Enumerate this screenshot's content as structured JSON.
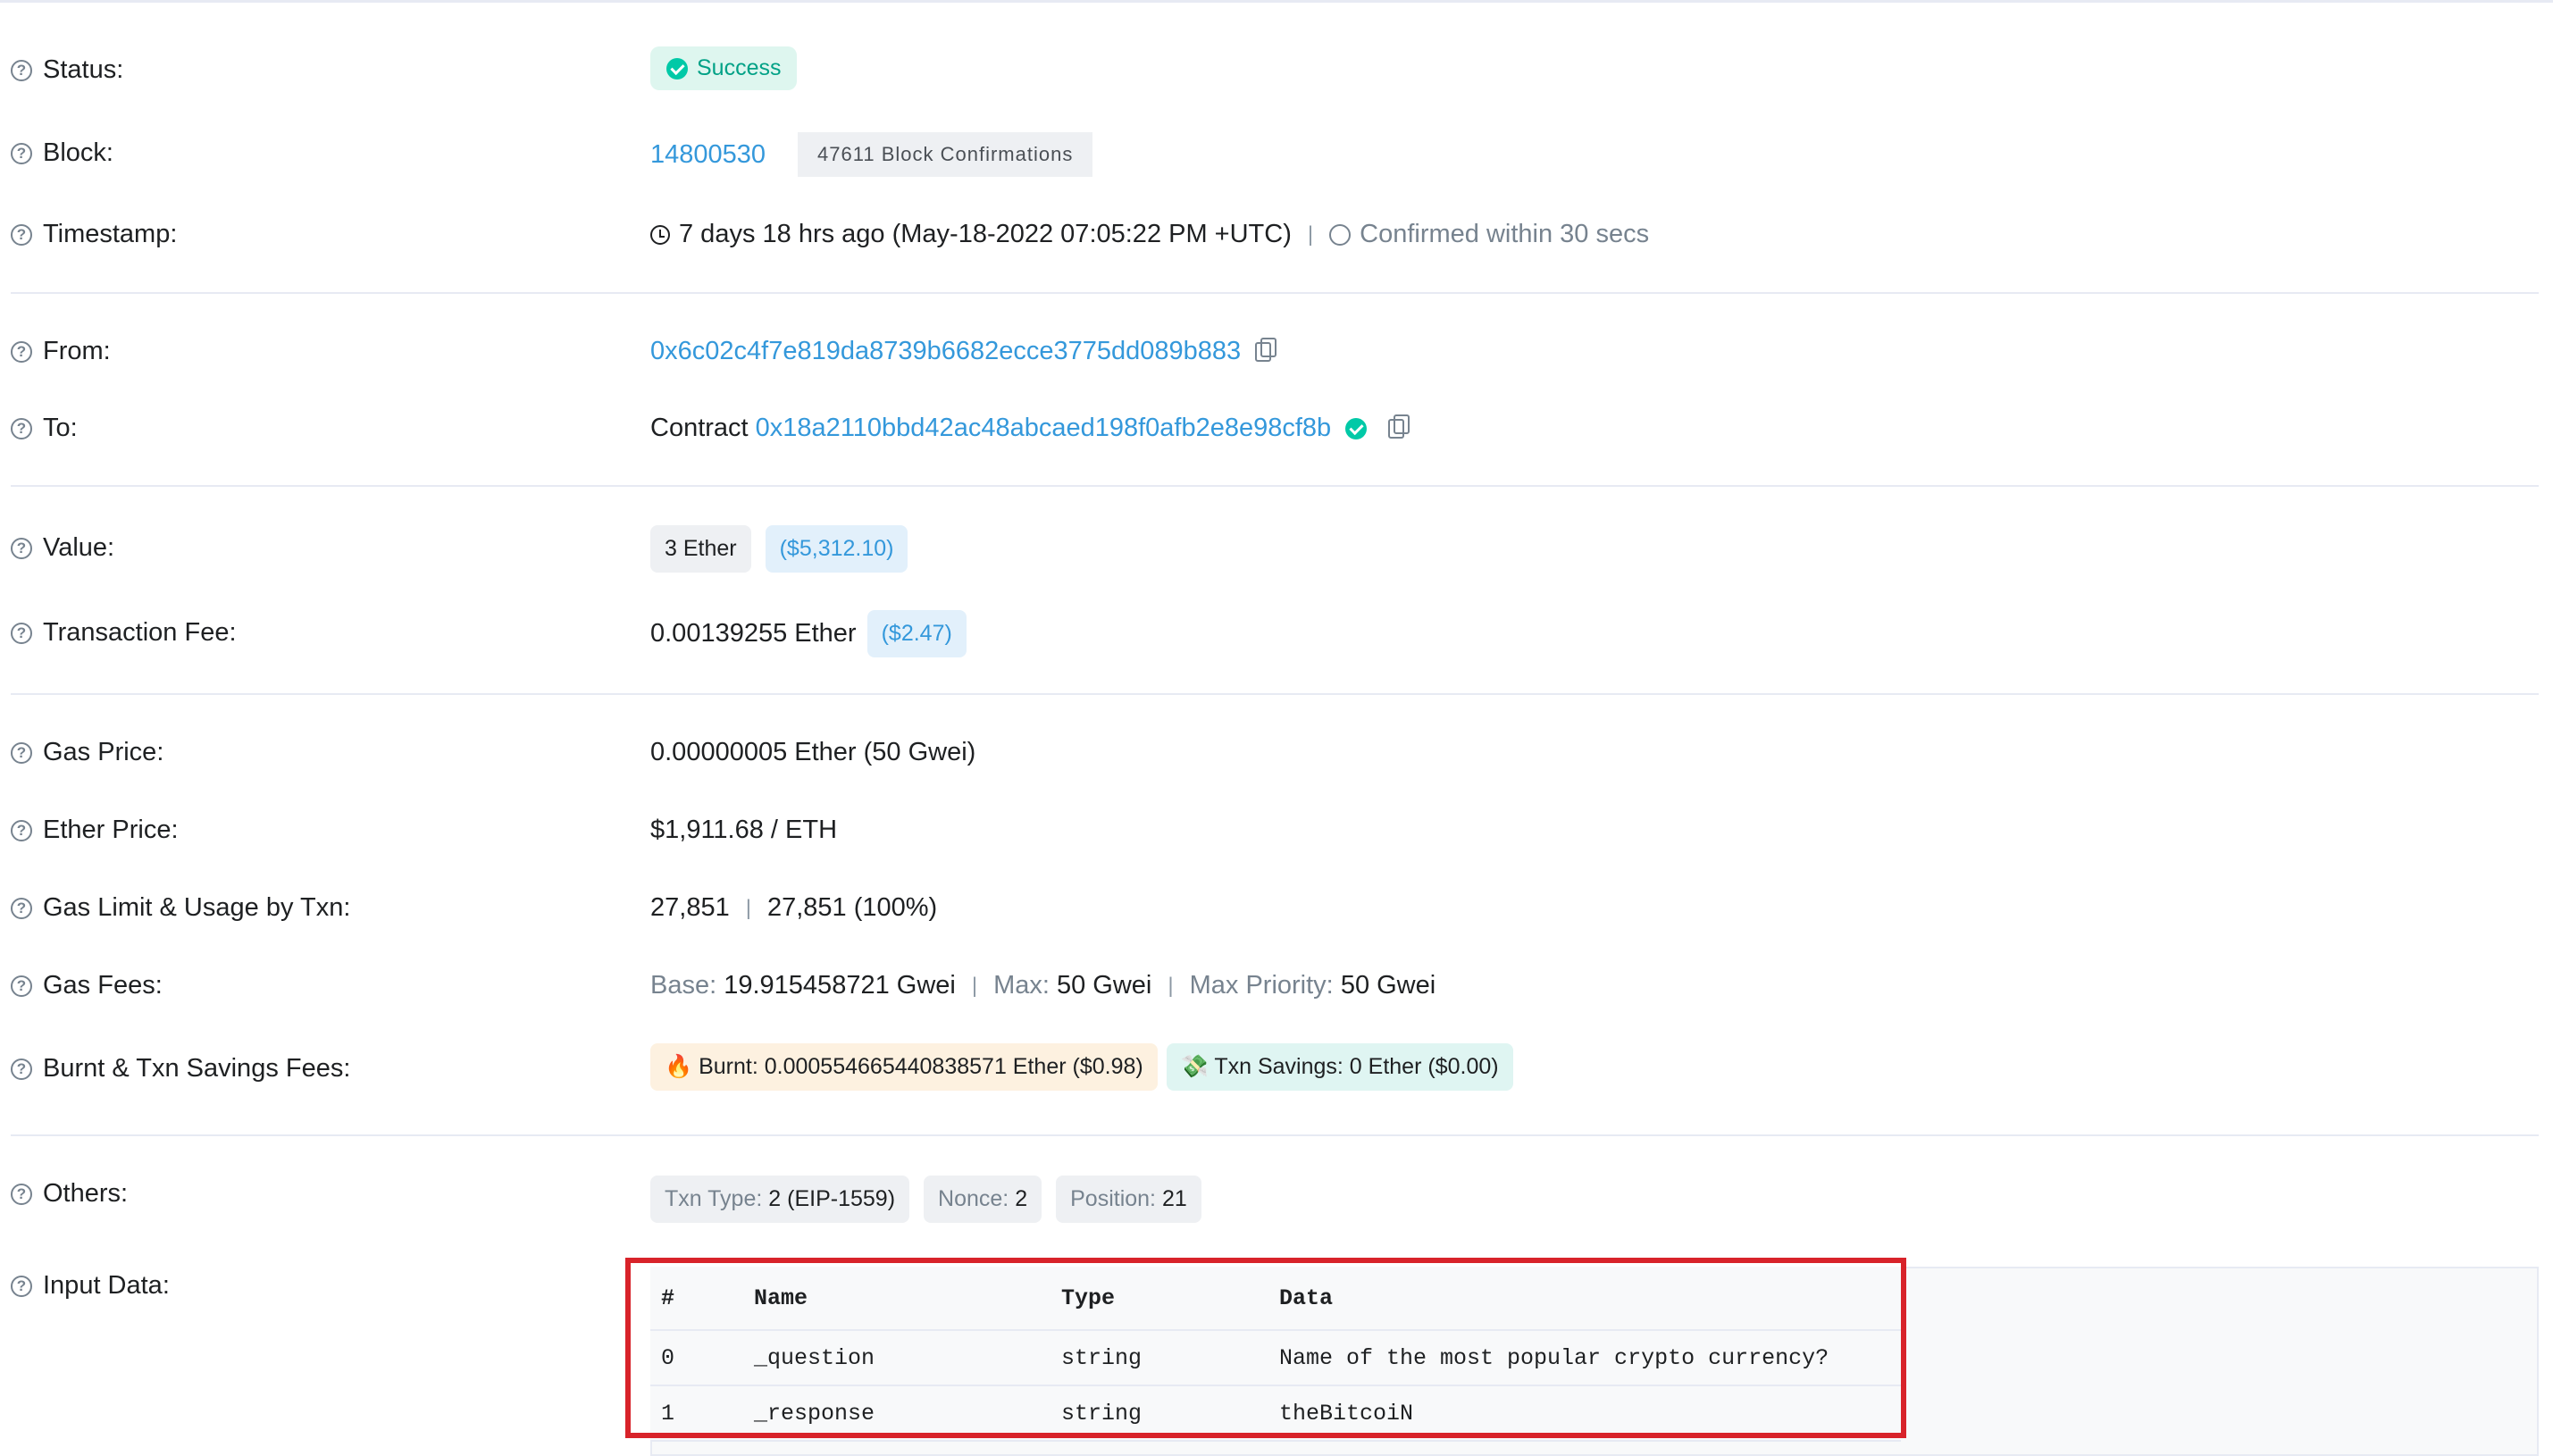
{
  "status": {
    "label": "Status:",
    "value": "Success"
  },
  "block": {
    "label": "Block:",
    "number": "14800530",
    "confirmations": "47611 Block Confirmations"
  },
  "timestamp": {
    "label": "Timestamp:",
    "value": "7 days 18 hrs ago (May-18-2022 07:05:22 PM +UTC)",
    "confirmed": "Confirmed within 30 secs"
  },
  "from": {
    "label": "From:",
    "address": "0x6c02c4f7e819da8739b6682ecce3775dd089b883"
  },
  "to": {
    "label": "To:",
    "prefix": "Contract",
    "address": "0x18a2110bbd42ac48abcaed198f0afb2e8e98cf8b"
  },
  "value": {
    "label": "Value:",
    "amount": "3 Ether",
    "usd": "($5,312.10)"
  },
  "fee": {
    "label": "Transaction Fee:",
    "amount": "0.00139255 Ether",
    "usd": "($2.47)"
  },
  "gas_price": {
    "label": "Gas Price:",
    "value": "0.00000005 Ether (50 Gwei)"
  },
  "ether_price": {
    "label": "Ether Price:",
    "value": "$1,911.68 / ETH"
  },
  "gas_limit": {
    "label": "Gas Limit & Usage by Txn:",
    "limit": "27,851",
    "usage": "27,851 (100%)"
  },
  "gas_fees": {
    "label": "Gas Fees:",
    "base_label": "Base:",
    "base_value": "19.915458721 Gwei",
    "max_label": "Max:",
    "max_value": "50 Gwei",
    "priority_label": "Max Priority:",
    "priority_value": "50 Gwei"
  },
  "burnt": {
    "label": "Burnt & Txn Savings Fees:",
    "burnt_icon": "🔥",
    "burnt_text": "Burnt: 0.000554665440838571 Ether ($0.98)",
    "savings_icon": "💸",
    "savings_text": "Txn Savings: 0 Ether ($0.00)"
  },
  "others": {
    "label": "Others:",
    "txn_type_label": "Txn Type:",
    "txn_type_value": "2 (EIP-1559)",
    "nonce_label": "Nonce:",
    "nonce_value": "2",
    "position_label": "Position:",
    "position_value": "21"
  },
  "input_data": {
    "label": "Input Data:",
    "headers": [
      "#",
      "Name",
      "Type",
      "Data"
    ],
    "rows": [
      [
        "0",
        "_question",
        "string",
        "Name of the most popular crypto currency?"
      ],
      [
        "1",
        "_response",
        "string",
        "theBitcoiN"
      ]
    ]
  },
  "separator": "|",
  "colors": {
    "link": "#3498db",
    "success": "#00c9a7",
    "highlight": "#d8232a"
  }
}
